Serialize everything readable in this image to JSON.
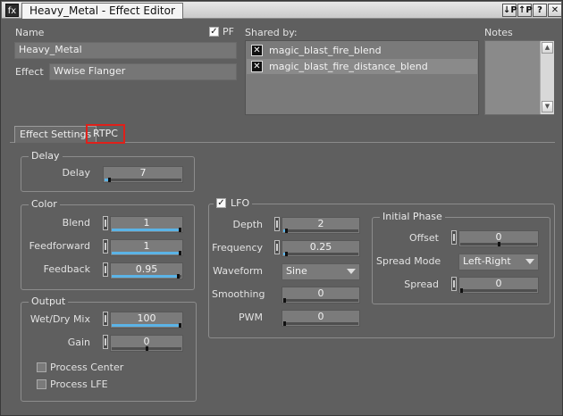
{
  "window": {
    "title": "Heavy_Metal - Effect Editor",
    "icon": "fx-icon",
    "toolbar_buttons": [
      "pin-icon",
      "pin-alt-icon",
      "help-icon",
      "close-icon"
    ],
    "toolbar_glyphs": [
      "↓P",
      "↑P",
      "?",
      "✕"
    ]
  },
  "header": {
    "name_label": "Name",
    "name_value": "Heavy_Metal",
    "pf_label": "PF",
    "pf_checked": true,
    "effect_label": "Effect",
    "effect_value": "Wwise Flanger",
    "shared_label": "Shared by:",
    "shared_items": [
      {
        "text": "magic_blast_fire_blend",
        "selected": false
      },
      {
        "text": "magic_blast_fire_distance_blend",
        "selected": true
      }
    ],
    "notes_label": "Notes"
  },
  "tabs": [
    {
      "label": "Effect Settings",
      "active": true
    },
    {
      "label": "RTPC",
      "highlighted": true
    }
  ],
  "delay_group": {
    "title": "Delay",
    "delay_label": "Delay",
    "delay_value": "7",
    "delay_level": 0.05
  },
  "color_group": {
    "title": "Color",
    "blend_label": "Blend",
    "blend_value": "1",
    "blend_level": 1.0,
    "feedforward_label": "Feedforward",
    "feedforward_value": "1",
    "feedforward_level": 1.0,
    "feedback_label": "Feedback",
    "feedback_value": "0.95",
    "feedback_level": 0.975
  },
  "output_group": {
    "title": "Output",
    "wetdry_label": "Wet/Dry Mix",
    "wetdry_value": "100",
    "wetdry_level": 1.0,
    "gain_label": "Gain",
    "gain_value": "0",
    "gain_level": 0.5,
    "process_center_label": "Process Center",
    "process_lfe_label": "Process LFE"
  },
  "lfo_group": {
    "title": "LFO",
    "enabled": true,
    "depth_label": "Depth",
    "depth_value": "2",
    "depth_level": 0.02,
    "frequency_label": "Frequency",
    "frequency_value": "0.25",
    "frequency_level": 0.02,
    "waveform_label": "Waveform",
    "waveform_value": "Sine",
    "smoothing_label": "Smoothing",
    "smoothing_value": "0",
    "smoothing_level": 0.0,
    "pwm_label": "PWM",
    "pwm_value": "0",
    "pwm_level": 0.0
  },
  "phase_group": {
    "title": "Initial Phase",
    "offset_label": "Offset",
    "offset_value": "0",
    "offset_level": 0.5,
    "spread_mode_label": "Spread Mode",
    "spread_mode_value": "Left-Right",
    "spread_label": "Spread",
    "spread_value": "0",
    "spread_level": 0.0
  },
  "colors": {
    "accent_fill": "#5bb3e6",
    "highlight_border": "#e0201a",
    "panel_bg": "#5f5f5f"
  }
}
